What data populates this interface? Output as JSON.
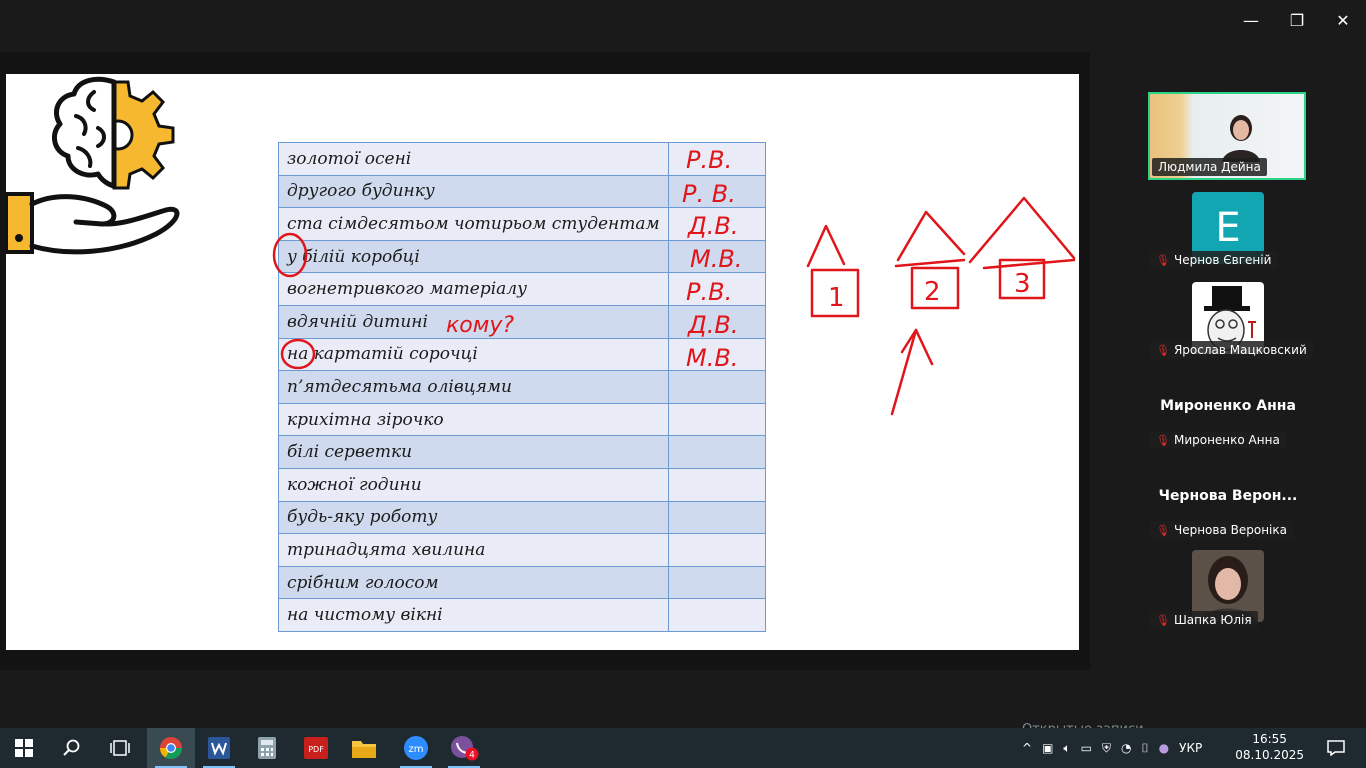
{
  "window_controls": {
    "minimize": "—",
    "restore": "❐",
    "close": "✕"
  },
  "table": {
    "rows": [
      {
        "word": "золотої осені",
        "answer": "Р.В."
      },
      {
        "word": "другого будинку",
        "answer": "Р. В."
      },
      {
        "word": "ста сімдесятьом чотирьом студентам",
        "answer": "Д.В."
      },
      {
        "word": "у білій коробці",
        "answer": "М.В."
      },
      {
        "word": "вогнетривкого матеріалу",
        "answer": "Р.В."
      },
      {
        "word": "вдячній дитині",
        "answer": "Д.В."
      },
      {
        "word": "на картатій сорочці",
        "answer": "М.В."
      },
      {
        "word": "п’ятдесятьма олівцями",
        "answer": ""
      },
      {
        "word": "крихітна зірочко",
        "answer": ""
      },
      {
        "word": "білі серветки",
        "answer": ""
      },
      {
        "word": "кожної години",
        "answer": ""
      },
      {
        "word": "будь-яку роботу",
        "answer": ""
      },
      {
        "word": "тринадцята хвилина",
        "answer": ""
      },
      {
        "word": "срібним голосом",
        "answer": ""
      },
      {
        "word": "на чистому вікні",
        "answer": ""
      }
    ]
  },
  "annotations": {
    "question": "кому?",
    "house1": "1",
    "house2": "2",
    "house3": "3"
  },
  "participants": {
    "p1": {
      "name": "Людмила Дейна"
    },
    "p2": {
      "name": "Чернов Євгеній",
      "initial": "E"
    },
    "p3": {
      "name": "Ярослав Мацковский"
    },
    "p4": {
      "display": "Мироненко Анна",
      "name": "Мироненко Анна"
    },
    "p5": {
      "display": "Чернова Верон...",
      "name": "Чернова Вероніка"
    },
    "p6": {
      "name": "Шапка Юлія"
    }
  },
  "taskbar": {
    "zoom_label": "zm",
    "viber_badge": "4",
    "pdf_label": "PDF",
    "ghost_text": "Открытые записи",
    "language": "УКР",
    "time": "16:55",
    "date": "08.10.2025"
  },
  "colors": {
    "ink": "#e0161b",
    "table_border": "#6b9bd2",
    "active_speaker": "#2ed38a"
  }
}
